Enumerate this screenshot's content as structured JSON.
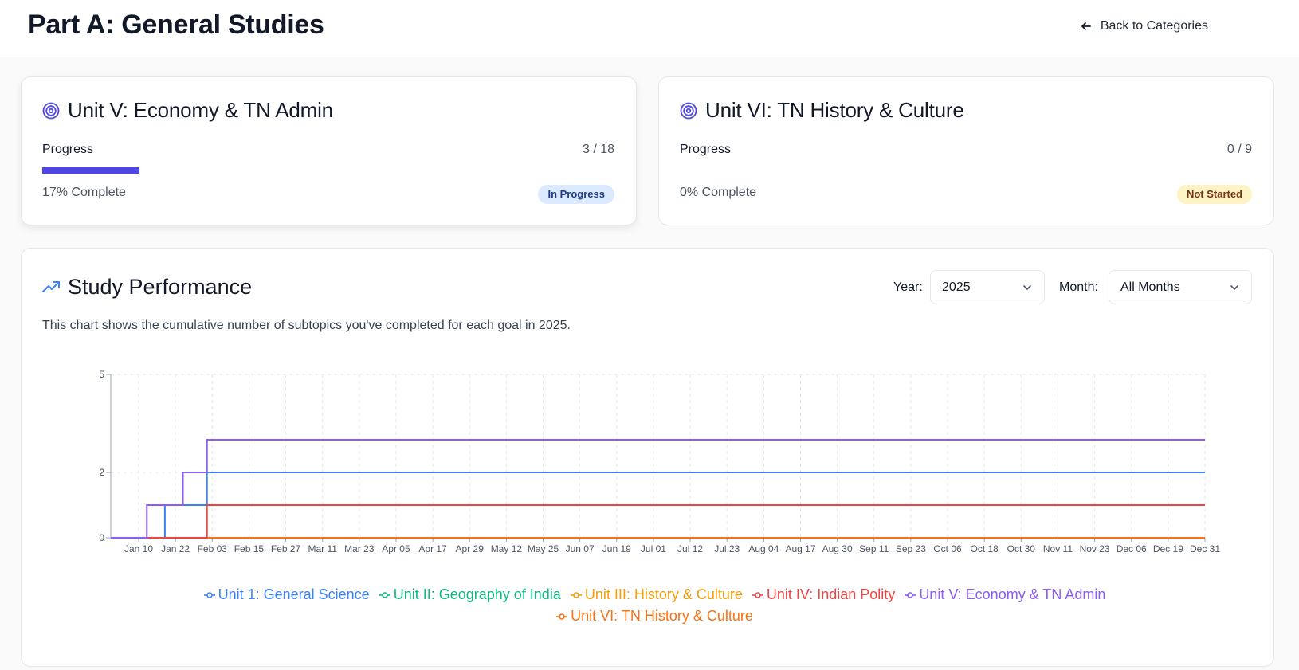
{
  "header": {
    "title": "Part A: General Studies",
    "back_label": "Back to Categories"
  },
  "units": [
    {
      "title": "Unit V: Economy & TN Admin",
      "progress_label": "Progress",
      "count": "3 / 18",
      "progress_fraction": 0.17,
      "complete_text": "17% Complete",
      "status": "In Progress"
    },
    {
      "title": "Unit VI: TN History & Culture",
      "progress_label": "Progress",
      "count": "0 / 9",
      "progress_fraction": 0,
      "complete_text": "0% Complete",
      "status": "Not Started"
    }
  ],
  "performance": {
    "title": "Study Performance",
    "description": "This chart shows the cumulative number of subtopics you've completed for each goal in 2025.",
    "year_label": "Year:",
    "year_value": "2025",
    "month_label": "Month:",
    "month_value": "All Months"
  },
  "colors": {
    "accent": "#4f46e5",
    "unit1": "#3b82f6",
    "unit2": "#10b981",
    "unit3": "#f59e0b",
    "unit4": "#ef4444",
    "unit5": "#8b5cf6",
    "unit6": "#f97316"
  },
  "chart_data": {
    "type": "line",
    "curve": "step-after",
    "x_ticks": [
      "Jan 10",
      "Jan 22",
      "Feb 03",
      "Feb 15",
      "Feb 27",
      "Mar 11",
      "Mar 23",
      "Apr 05",
      "Apr 17",
      "Apr 29",
      "May 12",
      "May 25",
      "Jun 07",
      "Jun 19",
      "Jul 01",
      "Jul 12",
      "Jul 23",
      "Aug 04",
      "Aug 17",
      "Aug 30",
      "Sep 11",
      "Sep 23",
      "Oct 06",
      "Oct 18",
      "Oct 30",
      "Nov 11",
      "Nov 23",
      "Dec 06",
      "Dec 19",
      "Dec 31"
    ],
    "y_ticks": [
      0,
      2,
      5
    ],
    "ylim": [
      0,
      5
    ],
    "xlim": [
      "2025-01-01",
      "2025-12-31"
    ],
    "grid": true,
    "legend": "bottom",
    "series": [
      {
        "name": "Unit 1: General Science",
        "color": "#3b82f6",
        "points": [
          [
            "2025-01-01",
            0
          ],
          [
            "2025-01-19",
            1
          ],
          [
            "2025-02-02",
            2
          ],
          [
            "2025-12-31",
            2
          ]
        ]
      },
      {
        "name": "Unit II: Geography of India",
        "color": "#10b981",
        "points": [
          [
            "2025-01-01",
            0
          ],
          [
            "2025-12-31",
            0
          ]
        ]
      },
      {
        "name": "Unit III: History & Culture",
        "color": "#f59e0b",
        "points": [
          [
            "2025-01-01",
            0
          ],
          [
            "2025-12-31",
            0
          ]
        ]
      },
      {
        "name": "Unit IV: Indian Polity",
        "color": "#ef4444",
        "points": [
          [
            "2025-01-01",
            0
          ],
          [
            "2025-02-02",
            1
          ],
          [
            "2025-12-31",
            1
          ]
        ]
      },
      {
        "name": "Unit V: Economy & TN Admin",
        "color": "#8b5cf6",
        "points": [
          [
            "2025-01-01",
            0
          ],
          [
            "2025-01-13",
            1
          ],
          [
            "2025-01-25",
            2
          ],
          [
            "2025-02-02",
            3
          ],
          [
            "2025-12-31",
            3
          ]
        ]
      },
      {
        "name": "Unit VI: TN History & Culture",
        "color": "#f97316",
        "points": [
          [
            "2025-01-01",
            0
          ],
          [
            "2025-12-31",
            0
          ]
        ]
      }
    ]
  }
}
